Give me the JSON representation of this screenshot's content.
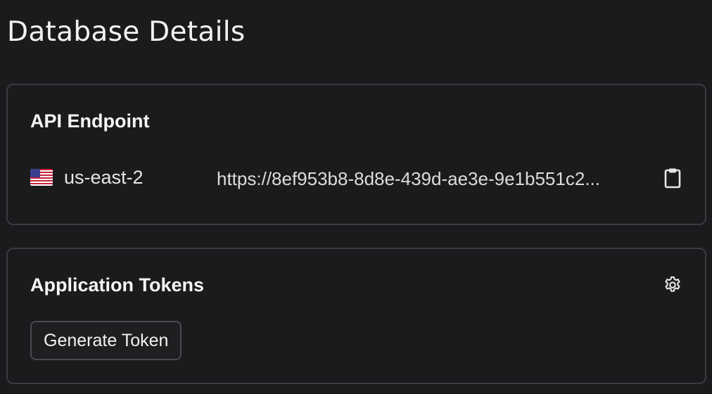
{
  "page": {
    "title": "Database Details"
  },
  "endpoint_card": {
    "title": "API Endpoint",
    "region": {
      "flag_icon": "us-flag-icon",
      "label": "us-east-2"
    },
    "url": "https://8ef953b8-8d8e-439d-ae3e-9e1b551c2...",
    "copy_icon": "clipboard-icon"
  },
  "tokens_card": {
    "title": "Application Tokens",
    "settings_icon": "gear-icon",
    "generate_button_label": "Generate Token"
  },
  "colors": {
    "background": "#1b1b1d",
    "card_border": "#3b3b40",
    "text": "#ffffff"
  }
}
